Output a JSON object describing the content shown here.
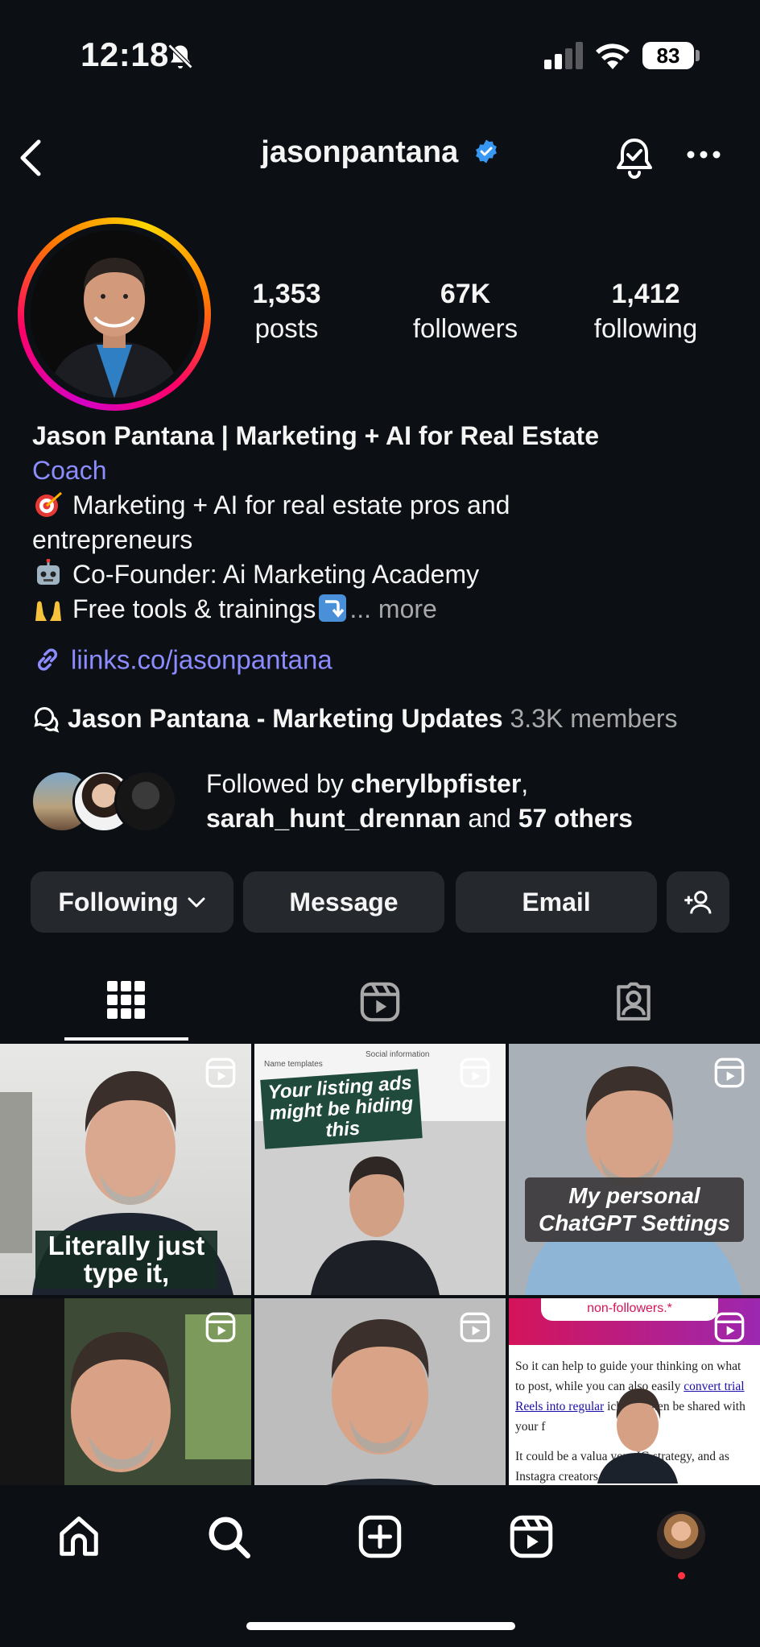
{
  "status_bar": {
    "time": "12:18",
    "battery": "83"
  },
  "header": {
    "username": "jasonpantana"
  },
  "stats": [
    {
      "value": "1,353",
      "label": "posts"
    },
    {
      "value": "67K",
      "label": "followers"
    },
    {
      "value": "1,412",
      "label": "following"
    }
  ],
  "bio": {
    "name": "Jason Pantana | Marketing + AI for Real Estate",
    "category": "Coach",
    "line1": "Marketing + AI for real estate pros and",
    "line1b": "entrepreneurs",
    "line2": "Co-Founder: Ai Marketing Academy",
    "line3": "Free tools & trainings",
    "more": "... more",
    "link": "liinks.co/jasonpantana"
  },
  "channel": {
    "name": "Jason Pantana - Marketing Updates",
    "members": "3.3K members"
  },
  "followed_by": {
    "prefix": "Followed by ",
    "user1": "cherylbpfister",
    "sep": ",",
    "user2": "sarah_hunt_drennan",
    "and": " and ",
    "others": "57 others"
  },
  "buttons": {
    "following": "Following",
    "message": "Message",
    "email": "Email"
  },
  "posts": {
    "p1_caption": "Literally just type it,",
    "p2_caption": "Your listing ads might be hiding this",
    "p2_screen_left": "Name templates",
    "p2_screen_right": "Social information",
    "p3_caption": "My personal ChatGPT Settings",
    "p6_banner": "non-followers.*",
    "p6_text": "So it can help to guide your thinking on what to post, while you can also easily",
    "p6_link": "convert trial Reels into regular",
    "p6_text2": "ich will then be shared with your f",
    "p6_text3": "It could be a valua       your IG strategy, and as Instagra         creators are"
  },
  "colors": {
    "accent_link": "#8c8cff",
    "button_bg": "#25292e",
    "background": "#0c1014",
    "verified": "#3897f0",
    "notification_dot": "#ff3040"
  },
  "icons": [
    "bell-off-icon",
    "signal-icon",
    "wifi-icon",
    "back-icon",
    "verified-icon",
    "notify-bell-icon",
    "more-icon",
    "link-icon",
    "channel-icon",
    "chevron-down-icon",
    "add-user-icon",
    "grid-icon",
    "reels-tab-icon",
    "tagged-icon",
    "reel-badge-icon",
    "home-icon",
    "search-icon",
    "create-icon",
    "reels-icon",
    "profile-avatar-icon"
  ]
}
